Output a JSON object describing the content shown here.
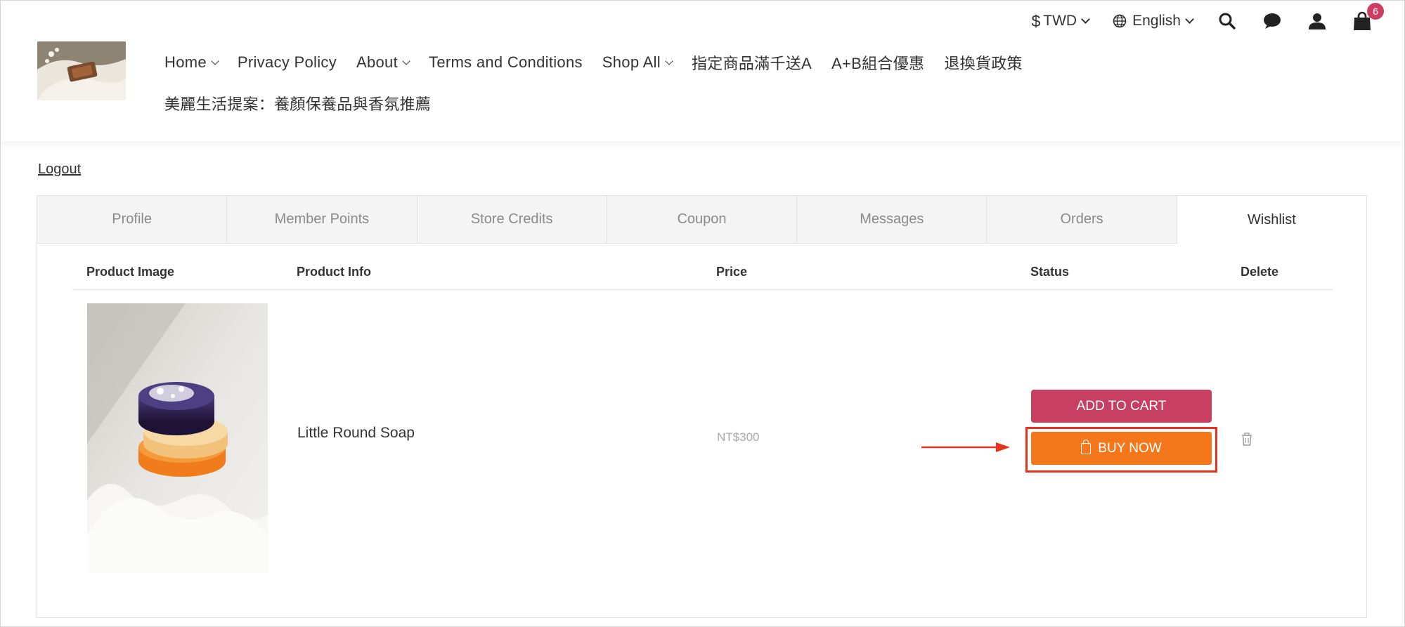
{
  "topbar": {
    "currency": "TWD",
    "currency_symbol": "$",
    "language": "English",
    "cart_count": "6"
  },
  "icons": {
    "currency": "dollar-icon",
    "language": "globe-icon",
    "search": "search-icon",
    "chat": "chat-bubble-icon",
    "account": "user-icon",
    "cart": "shopping-bag-icon",
    "delete": "trash-icon"
  },
  "nav": {
    "row1": [
      {
        "label": "Home",
        "dropdown": true
      },
      {
        "label": "Privacy Policy",
        "dropdown": false
      },
      {
        "label": "About",
        "dropdown": true
      },
      {
        "label": "Terms and Conditions",
        "dropdown": false
      },
      {
        "label": "Shop All",
        "dropdown": true
      },
      {
        "label": "指定商品滿千送A",
        "dropdown": false
      },
      {
        "label": "A+B組合優惠",
        "dropdown": false
      },
      {
        "label": "退換貨政策",
        "dropdown": false
      }
    ],
    "row2": [
      {
        "label": "美麗生活提案：養顏保養品與香氛推薦",
        "dropdown": false
      }
    ]
  },
  "account": {
    "logout_label": "Logout",
    "tabs": [
      {
        "label": "Profile",
        "active": false
      },
      {
        "label": "Member Points",
        "active": false
      },
      {
        "label": "Store Credits",
        "active": false
      },
      {
        "label": "Coupon",
        "active": false
      },
      {
        "label": "Messages",
        "active": false
      },
      {
        "label": "Orders",
        "active": false
      },
      {
        "label": "Wishlist",
        "active": true
      }
    ]
  },
  "wishlist": {
    "headers": {
      "image": "Product Image",
      "info": "Product Info",
      "price": "Price",
      "status": "Status",
      "delete": "Delete"
    },
    "items": [
      {
        "name": "Little Round Soap",
        "price": "NT$300",
        "add_to_cart_label": "ADD TO CART",
        "buy_now_label": "BUY NOW"
      }
    ]
  },
  "colors": {
    "add_to_cart": "#c73f62",
    "buy_now": "#f5771c",
    "highlight": "#e8321e",
    "badge": "#cc3f62"
  }
}
